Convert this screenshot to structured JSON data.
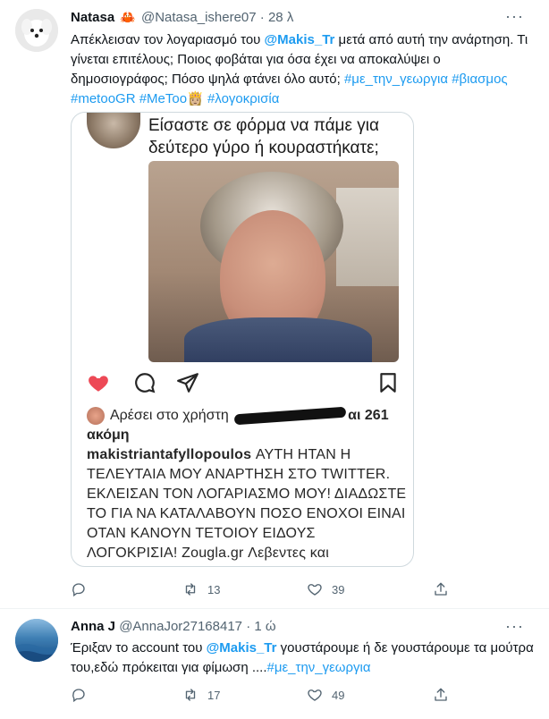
{
  "tweet1": {
    "name": "Natasa",
    "emoji": "🦀",
    "handle": "@Natasa_ishere07",
    "separator": "·",
    "time": "28 λ",
    "more_icon": "more-dots-icon",
    "text_a": "Απέκλεισαν τον λογαριασμό του ",
    "mention": "@Makis_Tr",
    "text_b": " μετά από αυτή την ανάρτηση. Τι γίνεται επιτέλους; Ποιος φοβάται για όσα έχει να αποκαλύψει ο δημοσιογράφος; Πόσο ψηλά φτάνει όλο αυτό; ",
    "hashtag_1": "#με_την_γεωργια",
    "hashtag_2": "#βιασμος",
    "hashtag_3": "#metooGR",
    "hashtag_4": "#MeToo",
    "emoji_2": "👸🏼",
    "hashtag_5": "#λογοκρισία",
    "media": {
      "caption_line1": "Είσαστε σε φόρμα να πάμε για",
      "caption_line2": "δεύτερο γύρο ή κουραστήκατε;",
      "likes_prefix": "Αρέσει στο χρήστη",
      "likes_suffix": "αι 261",
      "likes_line2": "ακόμη",
      "post_username": "makistriantafyllopoulos",
      "post_text": " ΑΥΤΗ ΗΤΑΝ Η ΤΕΛΕΥΤΑΙΑ ΜΟΥ ΑΝΑΡΤΗΣΗ ΣΤΟ TWITTER. ΕΚΛΕΙΣΑΝ ΤΟΝ ΛΟΓΑΡΙΑΣΜΟ ΜΟΥ! ΔΙΑΔΩΣΤΕ ΤΟ ΓΙΑ ΝΑ ΚΑΤΑΛΑΒΟΥΝ ΠΟΣΟ ΕΝΟΧΟΙ ΕΙΝΑΙ ΟΤΑΝ ΚΑΝΟΥΝ ΤΕΤΟΙΟΥ ΕΙΔΟΥΣ ΛΟΓΟΚΡΙΣΙΑ! Zougla.gr Λεβεντες και"
    },
    "actions": {
      "reply_count": "",
      "retweet_count": "13",
      "like_count": "39"
    }
  },
  "tweet2": {
    "name": "Anna J",
    "handle": "@AnnaJor27168417",
    "separator": "·",
    "time": "1 ώ",
    "more_icon": "more-dots-icon",
    "text_a": "Έριξαν το account του ",
    "mention": "@Makis_Tr",
    "text_b": " γουστάρουμε ή δε γουστάρουμε τα μούτρα του,εδώ πρόκειται για φίμωση ....",
    "hashtag_1": "#με_την_γεωργια",
    "actions": {
      "reply_count": "",
      "retweet_count": "17",
      "like_count": "49"
    }
  },
  "colors": {
    "link": "#1d9bf0",
    "text": "#0f1419",
    "secondary": "#536471",
    "heart": "#ed4956"
  }
}
